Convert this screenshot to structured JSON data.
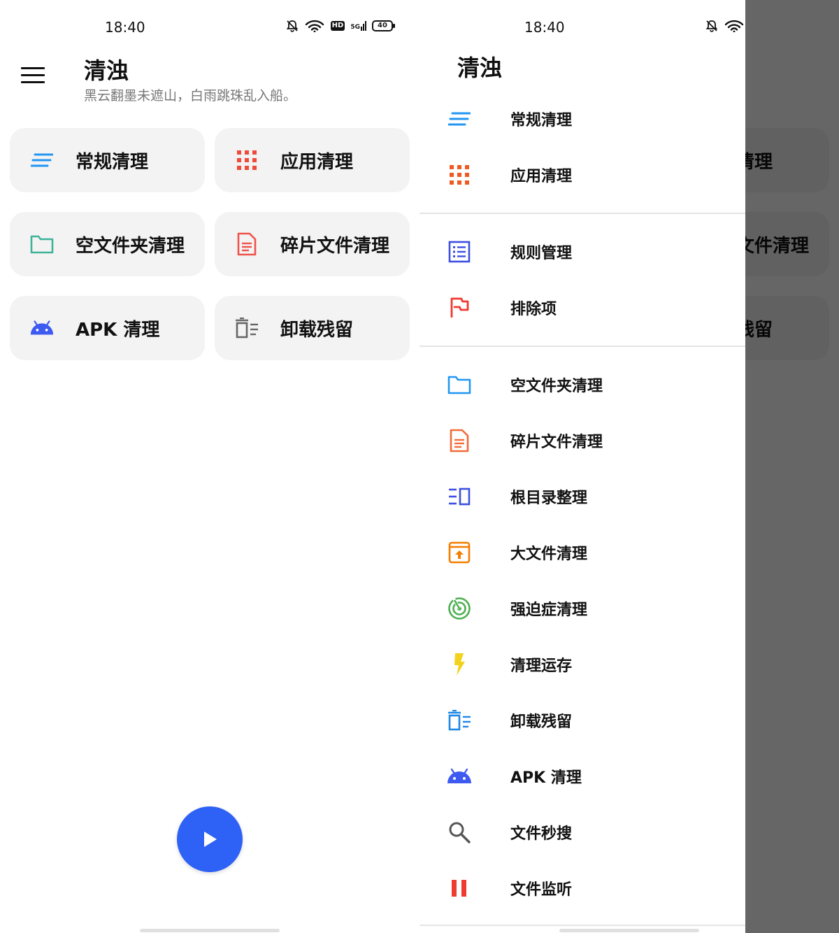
{
  "status": {
    "time": "18:40",
    "hd": "HD",
    "network": "5G",
    "battery": "40"
  },
  "app": {
    "title": "清浊",
    "subtitle": "黑云翻墨未遮山，白雨跳珠乱入船。"
  },
  "cards": [
    {
      "label": "常规清理",
      "icon": "lines-icon"
    },
    {
      "label": "应用清理",
      "icon": "apps-grid-icon"
    },
    {
      "label": "空文件夹清理",
      "icon": "folder-icon"
    },
    {
      "label": "碎片文件清理",
      "icon": "document-icon"
    },
    {
      "label": "APK 清理",
      "icon": "android-icon"
    },
    {
      "label": "卸载残留",
      "icon": "trash-list-icon"
    }
  ],
  "drawer": {
    "title": "清浊",
    "groups": [
      [
        {
          "label": "常规清理",
          "icon": "lines-icon"
        },
        {
          "label": "应用清理",
          "icon": "apps-grid-icon"
        }
      ],
      [
        {
          "label": "规则管理",
          "icon": "rules-list-icon"
        },
        {
          "label": "排除项",
          "icon": "flag-icon"
        }
      ],
      [
        {
          "label": "空文件夹清理",
          "icon": "folder-icon"
        },
        {
          "label": "碎片文件清理",
          "icon": "document-icon"
        },
        {
          "label": "根目录整理",
          "icon": "root-dir-icon"
        },
        {
          "label": "大文件清理",
          "icon": "archive-up-icon"
        },
        {
          "label": "强迫症清理",
          "icon": "radar-icon"
        },
        {
          "label": "清理运存",
          "icon": "bolt-icon"
        },
        {
          "label": "卸载残留",
          "icon": "trash-list-icon"
        },
        {
          "label": "APK 清理",
          "icon": "android-icon"
        },
        {
          "label": "文件秒搜",
          "icon": "search-icon"
        },
        {
          "label": "文件监听",
          "icon": "pause-icon"
        }
      ]
    ]
  },
  "colors": {
    "fab": "#2e61f5",
    "card_bg": "#f3f3f3",
    "scrim": "#666666"
  }
}
